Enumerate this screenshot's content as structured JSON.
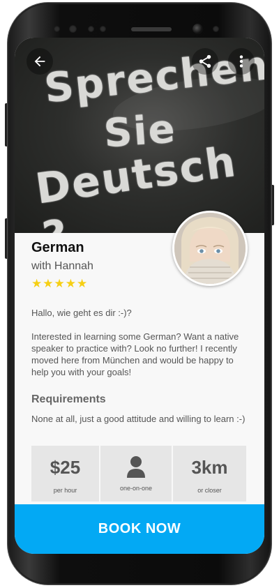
{
  "hero": {
    "line1": "Sprechen",
    "line2": "Sie",
    "line3": "Deutsch ?"
  },
  "course": {
    "title": "German",
    "tutor": "with Hannah",
    "rating": 5,
    "rating_max": 5,
    "star_color": "#f6cf14"
  },
  "description": {
    "greeting": "Hallo, wie geht es dir :-)?",
    "body": "Interested in learning some German? Want a native speaker to practice with? Look no further! I recently moved here from München and would be happy to help you with your goals!"
  },
  "requirements": {
    "heading": "Requirements",
    "text": "None at all, just a good attitude and willing to learn :-)"
  },
  "stats": {
    "price_value": "$25",
    "price_label": "per hour",
    "format_icon": "person-icon",
    "format_label": "one-on-one",
    "distance_value": "3km",
    "distance_label": "or closer"
  },
  "actions": {
    "book_label": "BOOK NOW",
    "accent_color": "#03a9f4",
    "back_icon": "arrow-back-icon",
    "share_icon": "share-icon",
    "more_icon": "more-vertical-icon"
  }
}
